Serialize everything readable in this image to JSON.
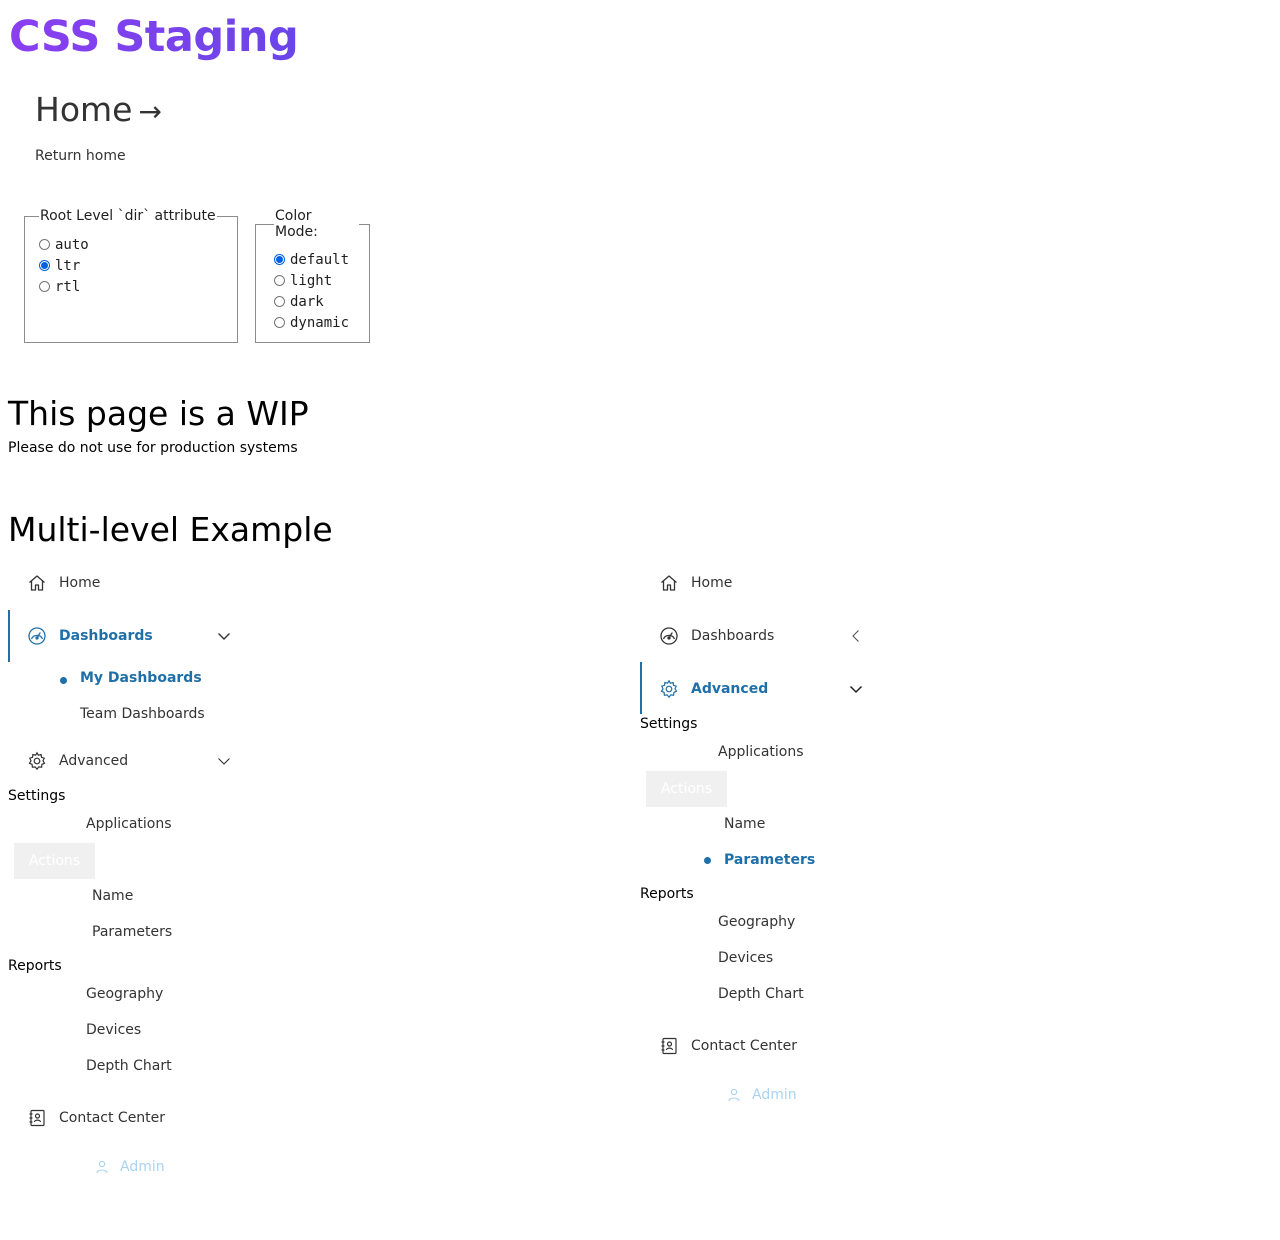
{
  "header": {
    "brand": "CSS Staging",
    "page_title": "Home",
    "arrow": "→",
    "return_link": "Return home"
  },
  "dir_options": {
    "legend": "Root Level `dir` attribute",
    "options": [
      "auto",
      "ltr",
      "rtl"
    ],
    "selected": "ltr"
  },
  "color_mode": {
    "legend": "Color Mode:",
    "options": [
      "default",
      "light",
      "dark",
      "dynamic"
    ],
    "selected": "default"
  },
  "wip": {
    "title": "This page is a WIP",
    "subtitle": "Please do not use for production systems"
  },
  "multi_level": {
    "title": "Multi-level Example",
    "left_nav": {
      "home": "Home",
      "dashboards": "Dashboards",
      "dashboards_children": [
        "My Dashboards",
        "Team Dashboards"
      ],
      "advanced": "Advanced",
      "settings_label": "Settings",
      "settings_children": [
        "Applications"
      ],
      "actions_label": "Actions",
      "actions_children": [
        "Name",
        "Parameters"
      ],
      "reports_label": "Reports",
      "reports_children": [
        "Geography",
        "Devices",
        "Depth Chart"
      ],
      "contact_center": "Contact Center",
      "admin": "Admin"
    },
    "right_nav": {
      "home": "Home",
      "dashboards": "Dashboards",
      "advanced": "Advanced",
      "settings_label": "Settings",
      "settings_children": [
        "Applications"
      ],
      "actions_label": "Actions",
      "actions_children": [
        "Name",
        "Parameters"
      ],
      "reports_label": "Reports",
      "reports_children": [
        "Geography",
        "Devices",
        "Depth Chart"
      ],
      "contact_center": "Contact Center",
      "admin": "Admin"
    }
  },
  "colors": {
    "brand_start": "#8a3ff0",
    "brand_end": "#6a45e8",
    "active_nav": "#1f6fa8",
    "radio_checked": "#0060df",
    "admin_disabled": "#a9d3ef"
  }
}
